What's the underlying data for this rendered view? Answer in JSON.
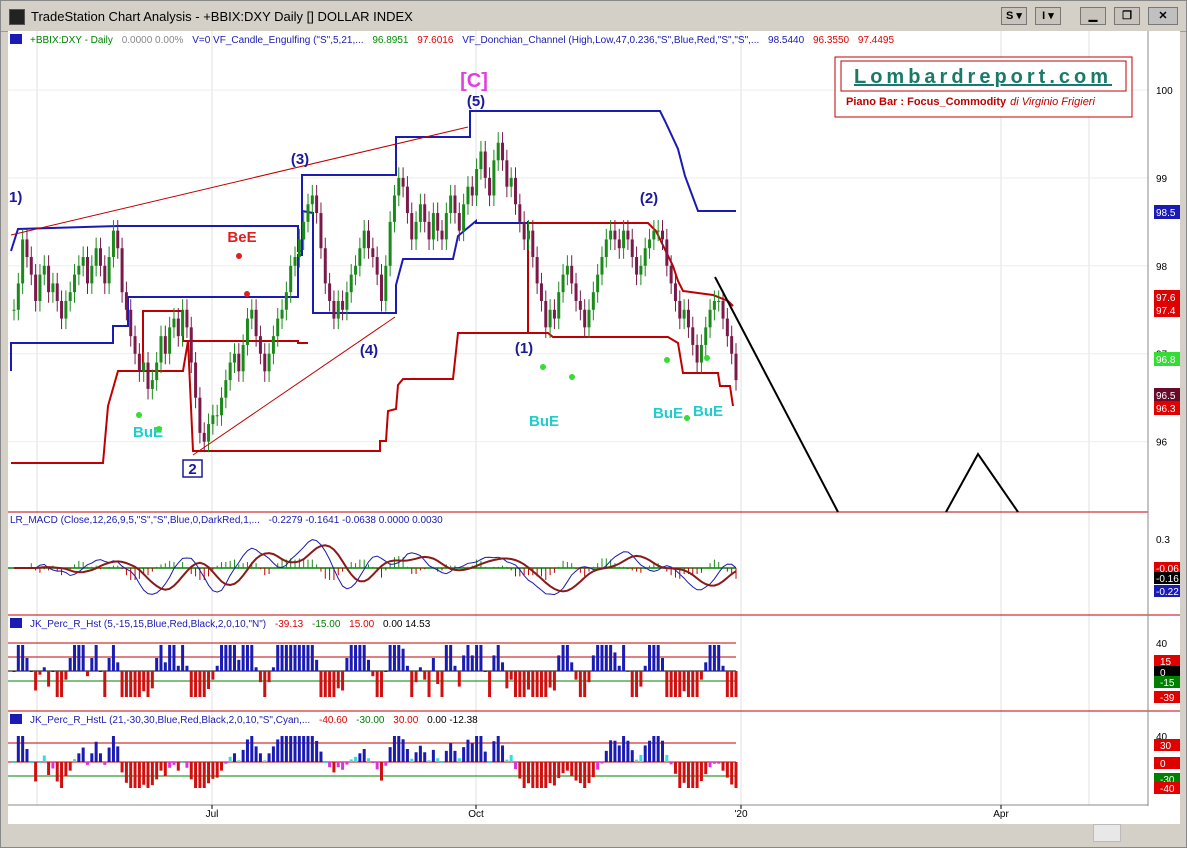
{
  "window": {
    "title": "TradeStation Chart Analysis - +BBIX:DXY Daily [] DOLLAR INDEX",
    "btn_s": "S",
    "btn_i": "I"
  },
  "panels": {
    "price": {
      "header_symbol": "+BBIX:DXY - Daily",
      "header_vals": "0.0000  0.00%",
      "header_ind1": "V=0  VF_Candle_Engulfing (\"S\",5,21,...",
      "header_ind1_v1": "96.8951",
      "header_ind1_v2": "97.6016",
      "header_ind2": "VF_Donchian_Channel (High,Low,47,0.236,\"S\",Blue,Red,\"S\",\"S\",...",
      "header_ind2_v1": "98.5440",
      "header_ind2_v2": "96.3550",
      "header_ind2_v3": "97.4495",
      "y_ticks": [
        "100",
        "99",
        "98",
        "97",
        "96"
      ],
      "price_tags": [
        {
          "text": "98.5",
          "color": "#1a1ab4",
          "fg": "#ffffff"
        },
        {
          "text": "97.6",
          "color": "#e00000",
          "fg": "#ffffff"
        },
        {
          "text": "97.4",
          "color": "#e00000",
          "fg": "#ffffff"
        },
        {
          "text": "96.8",
          "color": "#33dd33",
          "fg": "#ffffff"
        },
        {
          "text": "96.5",
          "color": "#6a0a2a",
          "fg": "#ffffff"
        },
        {
          "text": "96.3",
          "color": "#e00000",
          "fg": "#ffffff"
        }
      ],
      "labels": {
        "c_wave": "[C]",
        "w5": "(5)",
        "w3": "(3)",
        "w1_left": "1)",
        "w4": "(4)",
        "w2_low": "2",
        "w1_right": "(1)",
        "w2_right": "(2)",
        "bee": "BeE",
        "bue1": "BuE",
        "bue2": "BuE",
        "bue3": "BuE",
        "bue4": "BuE"
      }
    },
    "macd": {
      "header": "LR_MACD (Close,12,26,9,5,\"S\",\"S\",Blue,0,DarkRed,1,...",
      "values": "-0.2279   -0.1641   -0.0638   0.0000   0.0030",
      "y_tick": "0.3",
      "tags": [
        {
          "text": "-0.06",
          "color": "#e00000"
        },
        {
          "text": "-0.16",
          "color": "#000000"
        },
        {
          "text": "-0.22",
          "color": "#1a1ab4"
        }
      ]
    },
    "perc_r": {
      "header": "JK_Perc_R_Hst (5,-15,15,Blue,Red,Black,2,0,10,\"N\")",
      "v1": "-39.13",
      "v2": "-15.00",
      "v3": "15.00",
      "v4": "0.00  14.53",
      "y_tick": "40",
      "tags": [
        {
          "text": "15",
          "color": "#e00000"
        },
        {
          "text": "0",
          "color": "#000000"
        },
        {
          "text": "-15",
          "color": "#008000"
        },
        {
          "text": "-39",
          "color": "#e00000"
        }
      ]
    },
    "perc_rl": {
      "header": "JK_Perc_R_HstL (21,-30,30,Blue,Red,Black,2,0,10,\"S\",Cyan,...",
      "v1": "-40.60",
      "v2": "-30.00",
      "v3": "30.00",
      "v4": "0.00  -12.38",
      "y_tick": "40",
      "tags": [
        {
          "text": "30",
          "color": "#e00000"
        },
        {
          "text": "0",
          "color": "#e00000"
        },
        {
          "text": "-30",
          "color": "#008000"
        },
        {
          "text": "-40",
          "color": "#e00000"
        }
      ]
    }
  },
  "x_axis": [
    "Jul",
    "Oct",
    "'20",
    "Apr"
  ],
  "branding": {
    "site": "Lombardreport.com",
    "subtitle": "Piano Bar : Focus_Commodity",
    "author": "di Virginio Frigieri"
  },
  "chart_data": {
    "type": "candlestick",
    "title": "+BBIX:DXY Daily [] DOLLAR INDEX",
    "y_range": [
      95.2,
      100.5
    ],
    "close": [
      97.5,
      97.8,
      98.3,
      98.1,
      97.9,
      97.6,
      97.9,
      98.0,
      97.7,
      97.8,
      97.6,
      97.4,
      97.6,
      97.7,
      97.9,
      98.0,
      98.1,
      97.8,
      98.0,
      98.2,
      98.0,
      97.8,
      98.1,
      98.4,
      98.2,
      97.7,
      97.5,
      97.2,
      97.0,
      96.8,
      96.9,
      96.6,
      96.7,
      96.9,
      97.2,
      97.0,
      97.3,
      97.4,
      97.2,
      97.5,
      97.3,
      96.9,
      96.5,
      96.1,
      96.0,
      96.2,
      96.3,
      96.3,
      96.5,
      96.7,
      96.9,
      97.0,
      96.8,
      97.1,
      97.4,
      97.5,
      97.2,
      97.0,
      96.8,
      97.0,
      97.2,
      97.4,
      97.5,
      97.7,
      98.0,
      98.1,
      98.3,
      98.5,
      98.7,
      98.8,
      98.6,
      98.2,
      97.8,
      97.6,
      97.4,
      97.6,
      97.5,
      97.7,
      97.9,
      98.0,
      98.2,
      98.4,
      98.2,
      98.1,
      97.9,
      97.6,
      98.0,
      98.5,
      98.8,
      99.0,
      98.9,
      98.6,
      98.3,
      98.5,
      98.7,
      98.5,
      98.3,
      98.6,
      98.4,
      98.3,
      98.6,
      98.8,
      98.6,
      98.4,
      98.7,
      98.9,
      98.8,
      99.1,
      99.3,
      99.0,
      98.8,
      99.2,
      99.4,
      99.2,
      98.9,
      99.0,
      98.7,
      98.5,
      98.3,
      98.4,
      98.1,
      97.8,
      97.6,
      97.3,
      97.5,
      97.4,
      97.7,
      97.9,
      98.0,
      97.8,
      97.6,
      97.5,
      97.3,
      97.5,
      97.7,
      97.9,
      98.1,
      98.3,
      98.4,
      98.3,
      98.2,
      98.4,
      98.3,
      98.1,
      97.9,
      98.0,
      98.2,
      98.3,
      98.4,
      98.4,
      98.3,
      98.0,
      97.8,
      97.6,
      97.4,
      97.5,
      97.3,
      97.1,
      96.9,
      97.1,
      97.3,
      97.5,
      97.6,
      97.6,
      97.4,
      97.2,
      97.0,
      96.7
    ]
  }
}
